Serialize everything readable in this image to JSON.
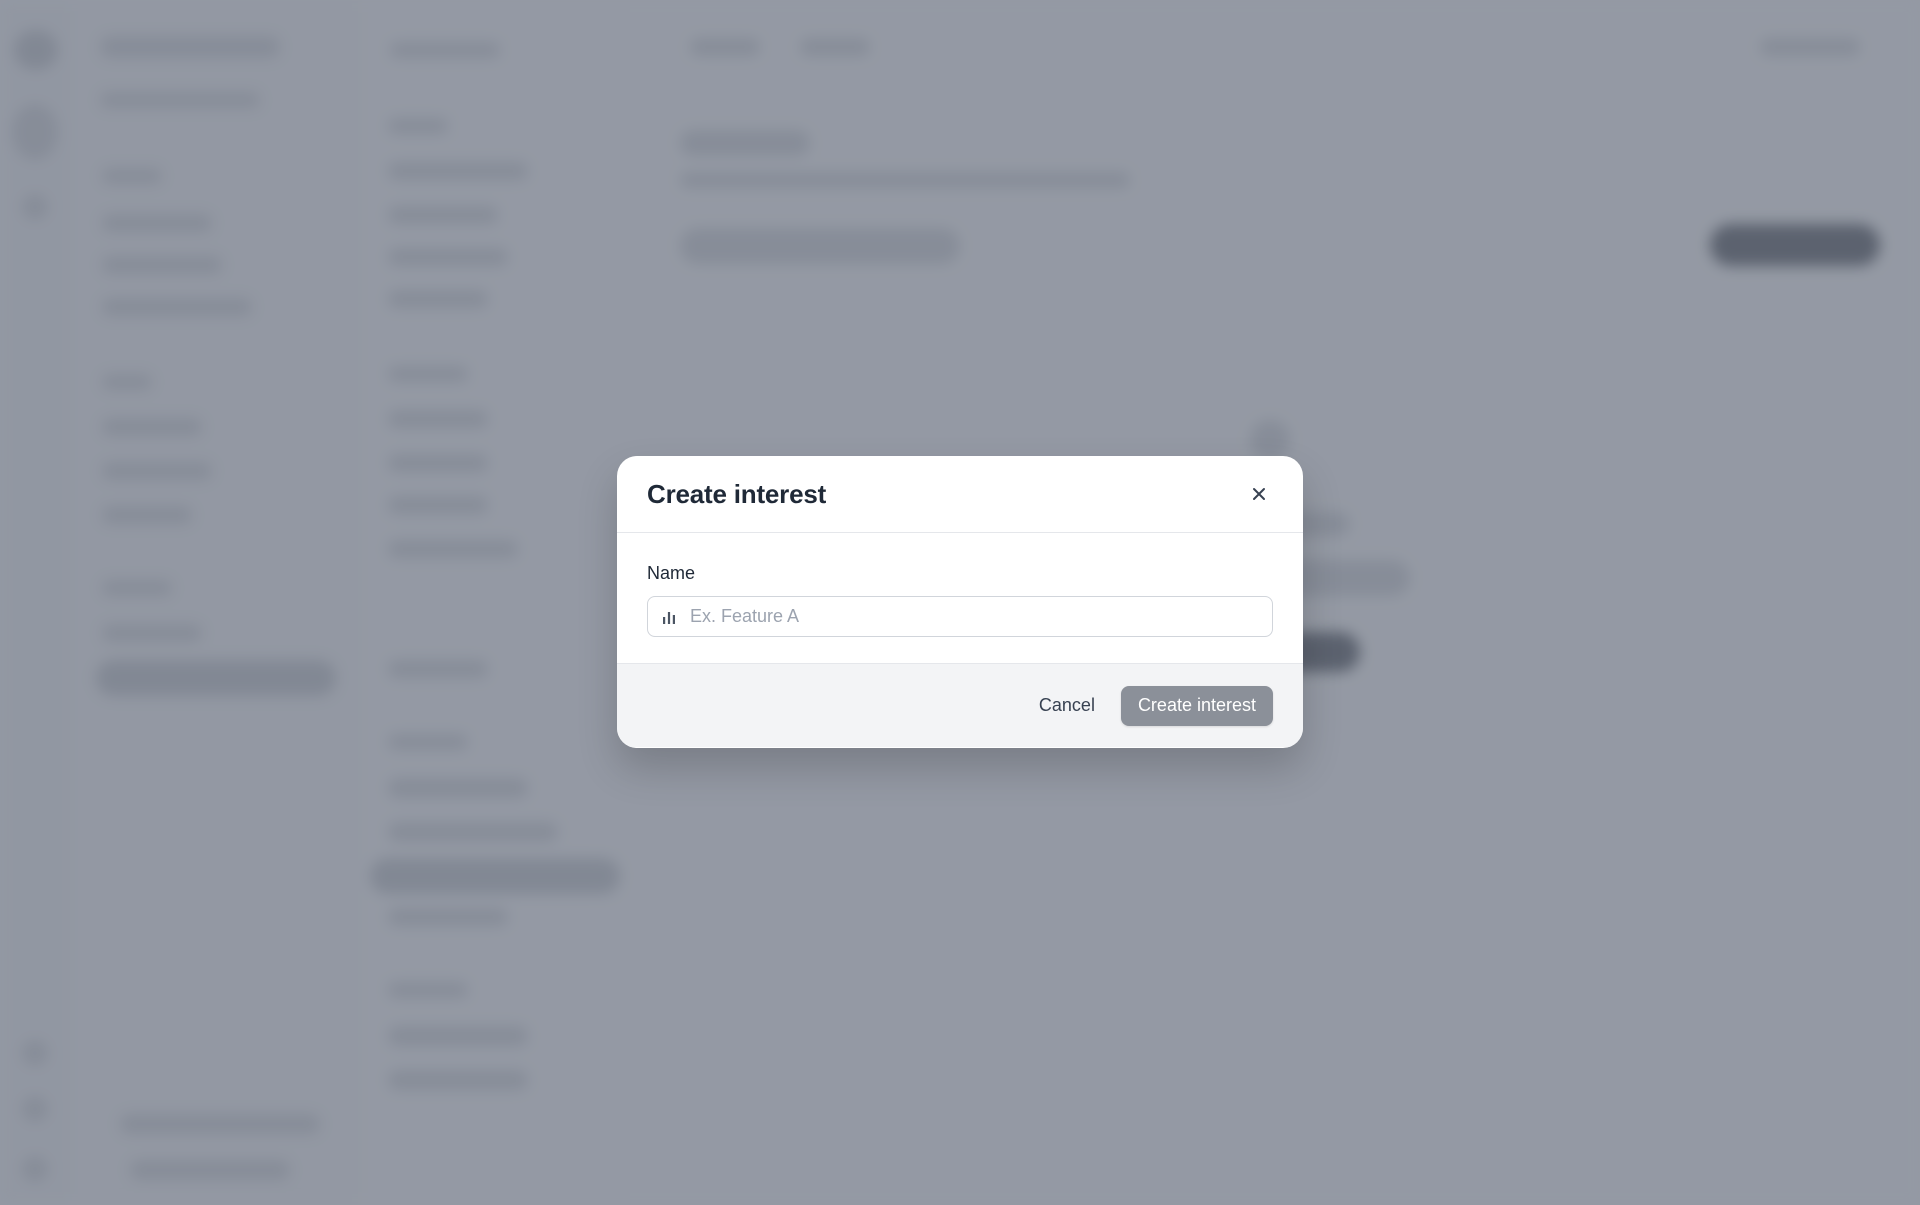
{
  "modal": {
    "title": "Create interest",
    "close_icon": "close-icon",
    "name_label": "Name",
    "name_input": {
      "value": "",
      "placeholder": "Ex. Feature A",
      "icon": "bar-chart-icon"
    },
    "cancel_label": "Cancel",
    "submit_label": "Create interest"
  },
  "colors": {
    "overlay": "#6b7280",
    "submit_button_disabled": "#8b9099",
    "primary_dark": "#3a3f48"
  }
}
